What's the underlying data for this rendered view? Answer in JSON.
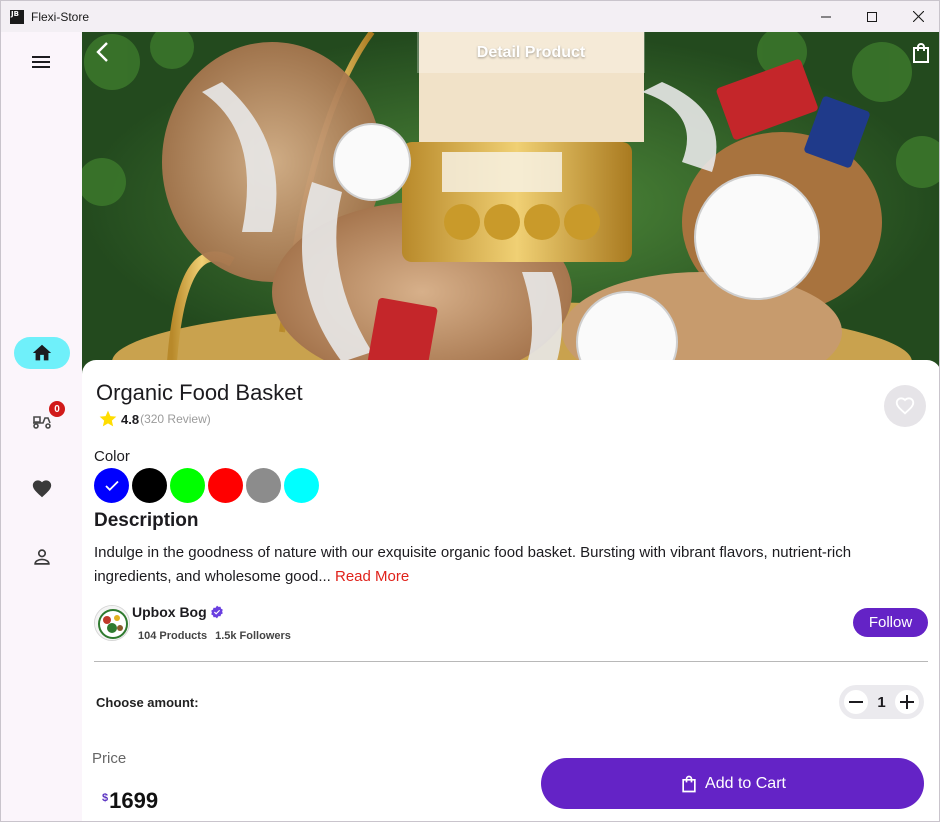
{
  "window": {
    "title": "Flexi-Store",
    "icon_text": "JB"
  },
  "rail": {
    "items": [
      {
        "icon": "home-icon",
        "active": true
      },
      {
        "icon": "delivery-scooter-icon",
        "badge": "0"
      },
      {
        "icon": "heart-icon"
      },
      {
        "icon": "person-icon"
      }
    ]
  },
  "header": {
    "title": "Detail Product"
  },
  "product": {
    "name": "Organic Food Basket",
    "rating": "4.8",
    "reviews": "(320 Review)",
    "color_label": "Color",
    "colors": [
      "#0000ff",
      "#000000",
      "#00ff00",
      "#ff0000",
      "#8c8c8c",
      "#00ffff"
    ],
    "selected_color": 0,
    "description_title": "Description",
    "description": "Indulge in the goodness of nature with our exquisite organic food basket. Bursting with vibrant flavors, nutrient-rich ingredients, and wholesome good...",
    "read_more": "Read More"
  },
  "store": {
    "name": "Upbox Bog",
    "products": "104 Products",
    "followers": "1.5k Followers",
    "follow_label": "Follow"
  },
  "amount": {
    "label": "Choose amount:",
    "quantity": "1"
  },
  "price": {
    "label": "Price",
    "currency": "$",
    "value": "1699"
  },
  "cart": {
    "label": "Add to Cart"
  },
  "colors": {
    "accent": "#6423c6",
    "rail_active": "#6ff0fa",
    "link": "#e0221b"
  }
}
